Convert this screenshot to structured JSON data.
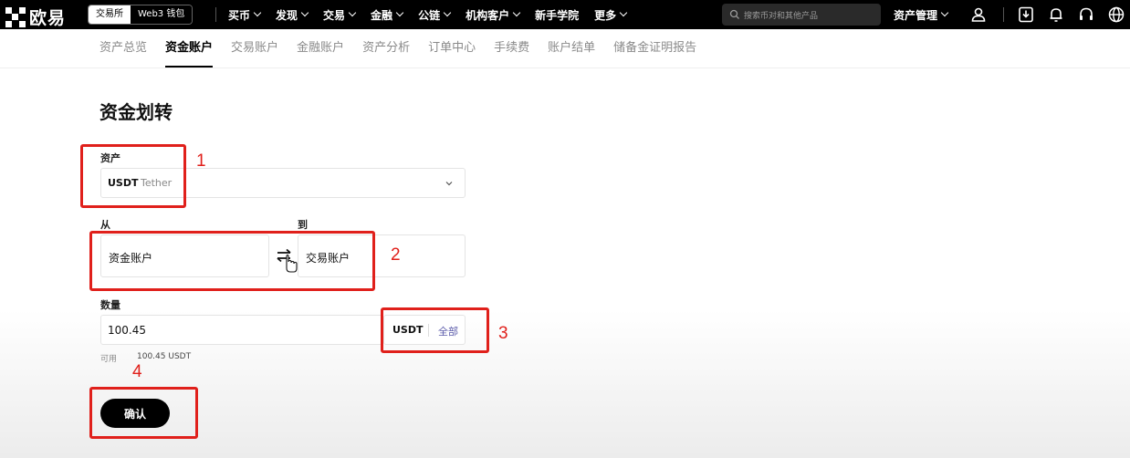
{
  "header": {
    "logo_text": "欧易",
    "switch": {
      "exchange": "交易所",
      "wallet": "Web3 钱包"
    },
    "nav": [
      "买币",
      "发现",
      "交易",
      "金融",
      "公链",
      "机构客户",
      "新手学院",
      "更多"
    ],
    "search_placeholder": "搜索币对和其他产品",
    "asset_management": "资产管理"
  },
  "subnav": {
    "items": [
      "资产总览",
      "资金账户",
      "交易账户",
      "金融账户",
      "资产分析",
      "订单中心",
      "手续费",
      "账户结单",
      "储备金证明报告"
    ],
    "active": "资金账户"
  },
  "form": {
    "title": "资金划转",
    "asset_label": "资产",
    "asset_symbol": "USDT",
    "asset_name": "Tether",
    "from_label": "从",
    "to_label": "到",
    "from_value": "资金账户",
    "to_value": "交易账户",
    "amount_label": "数量",
    "amount_value": "100.45",
    "amount_unit": "USDT",
    "all_label": "全部",
    "available_label": "可用",
    "available_value": "100.45 USDT",
    "confirm_label": "确认"
  },
  "annotations": [
    "1",
    "2",
    "3",
    "4"
  ],
  "colors": {
    "annotation": "#e0201b",
    "topbar": "#000000",
    "active_tab": "#000000"
  }
}
